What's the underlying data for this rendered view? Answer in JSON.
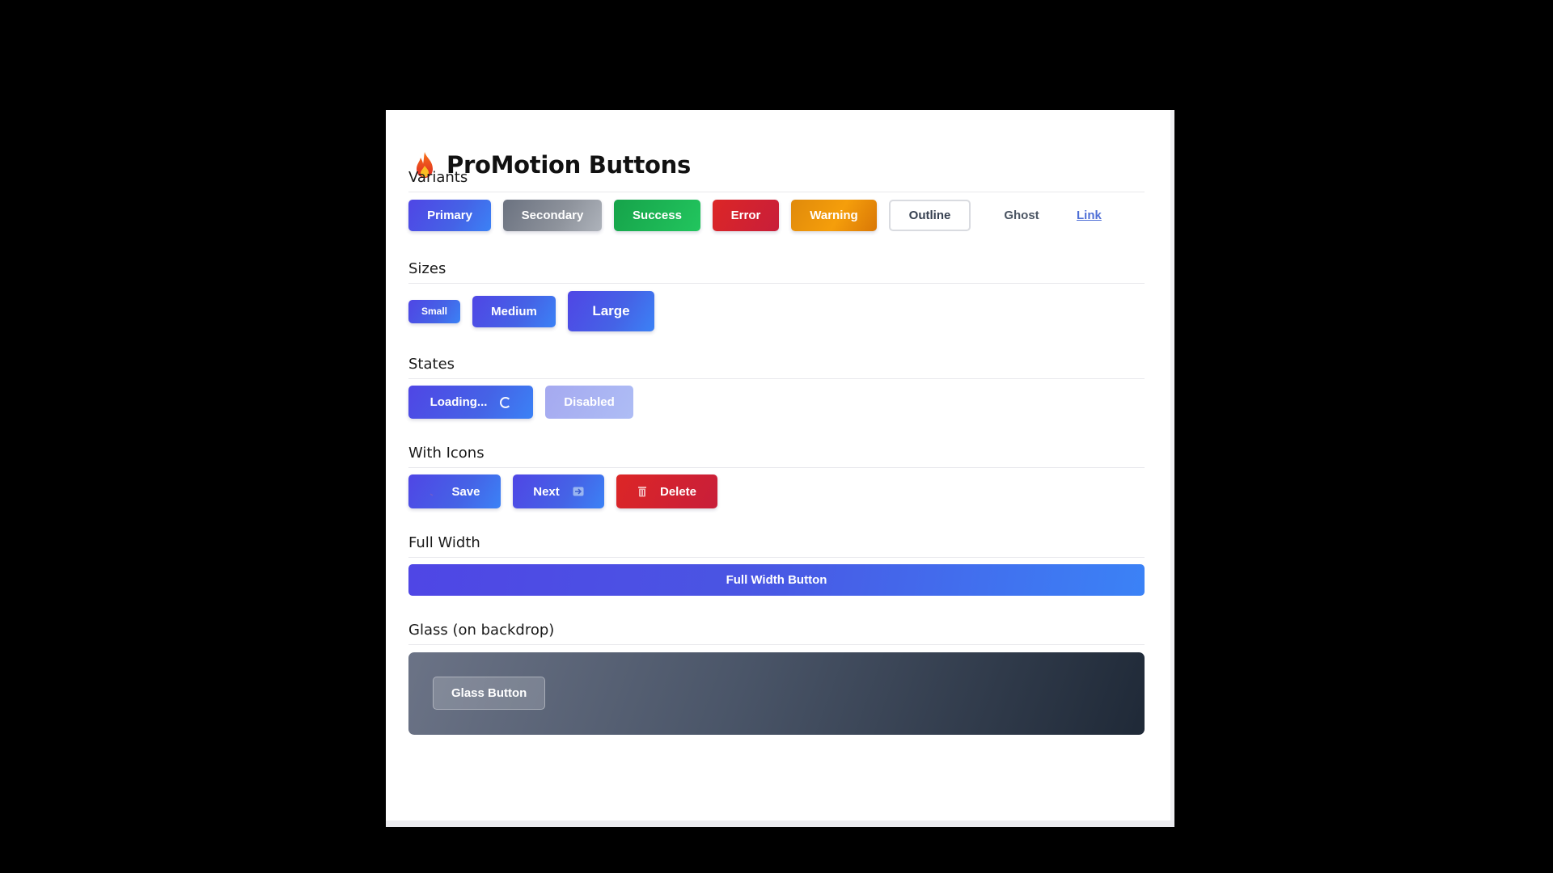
{
  "header": {
    "title": "ProMotion Buttons",
    "icon": "flame-icon"
  },
  "variants": {
    "title": "Variants",
    "buttons": [
      "Primary",
      "Secondary",
      "Success",
      "Error",
      "Warning",
      "Outline",
      "Ghost",
      "Link"
    ]
  },
  "sizes": {
    "title": "Sizes",
    "buttons": [
      "Small",
      "Medium",
      "Large"
    ]
  },
  "states": {
    "title": "States",
    "loading_label": "Loading...",
    "disabled_label": "Disabled"
  },
  "with_icons": {
    "title": "With Icons",
    "save_label": "Save",
    "next_label": "Next",
    "delete_label": "Delete"
  },
  "full_width": {
    "title": "Full Width",
    "button_label": "Full Width Button"
  },
  "glass": {
    "title": "Glass (on backdrop)",
    "button_label": "Glass Button"
  },
  "colors": {
    "primary": "#4f46e5",
    "secondary": "#6b7280",
    "success": "#22c55e",
    "error": "#dc2626",
    "warning": "#f59e0b"
  }
}
